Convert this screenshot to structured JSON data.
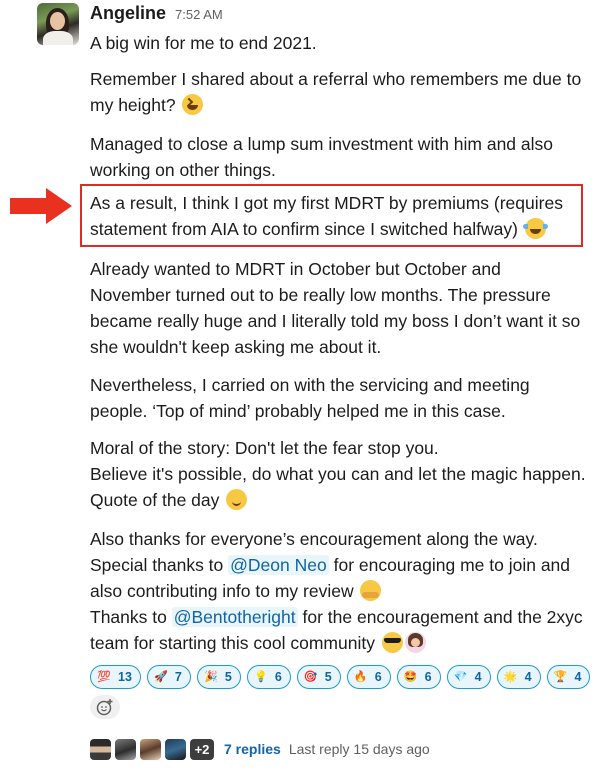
{
  "message": {
    "author": "Angeline",
    "time": "7:52 AM",
    "paragraphs": {
      "p1": "A big win for me to end 2021.",
      "p2a": "Remember I shared about a referral who remembers me due to",
      "p2b": "my height?",
      "p3a": "Managed to close a lump sum investment with him and also",
      "p3b": "working on other things.",
      "p4a": "As a result, I think I got my first MDRT by premiums (requires",
      "p4b": "statement from AIA to confirm since I switched halfway)",
      "p5a": "Already wanted to MDRT in October but October and",
      "p5b": "November turned out to be really low months. The pressure",
      "p5c": "became really huge and I literally told my boss I don’t want it so",
      "p5d": "she wouldn't keep asking me about it.",
      "p6a": "Nevertheless, I carried on with the servicing and meeting",
      "p6b": "people. ‘Top of mind’ probably helped me in this case.",
      "p7a": "Moral of the story: Don't let the fear stop you.",
      "p7b": "Believe it's possible, do what you can and let the magic happen.",
      "p7c": "Quote of the day",
      "p8a": "Also thanks for everyone’s encouragement along the way.",
      "p8b_pre": "Special thanks to",
      "p8b_mention": "@Deon Neo",
      "p8b_post": "for encouraging me to join and",
      "p8c": "also contributing info to my review",
      "p8d_pre": "Thanks to",
      "p8d_mention": "@Bentotheright",
      "p8d_post": "for the encouragement and the 2xyc",
      "p8e": "team for starting this cool community"
    }
  },
  "reactions": [
    {
      "emoji": "💯",
      "count": "13"
    },
    {
      "emoji": "🚀",
      "count": "7"
    },
    {
      "emoji": "🎉",
      "count": "5"
    },
    {
      "emoji": "💡",
      "count": "6"
    },
    {
      "emoji": "🎯",
      "count": "5"
    },
    {
      "emoji": "🔥",
      "count": "6"
    },
    {
      "emoji": "🤩",
      "count": "6"
    },
    {
      "emoji": "💎",
      "count": "4"
    },
    {
      "emoji": "🌟",
      "count": "4"
    },
    {
      "emoji": "🏆",
      "count": "4"
    }
  ],
  "thread": {
    "extra_count": "+2",
    "replies": "7 replies",
    "last_reply": "Last reply 15 days ago"
  },
  "colors": {
    "link": "#1264a3",
    "highlight_box": "#e02a2a",
    "arrow": "#e8311f"
  }
}
